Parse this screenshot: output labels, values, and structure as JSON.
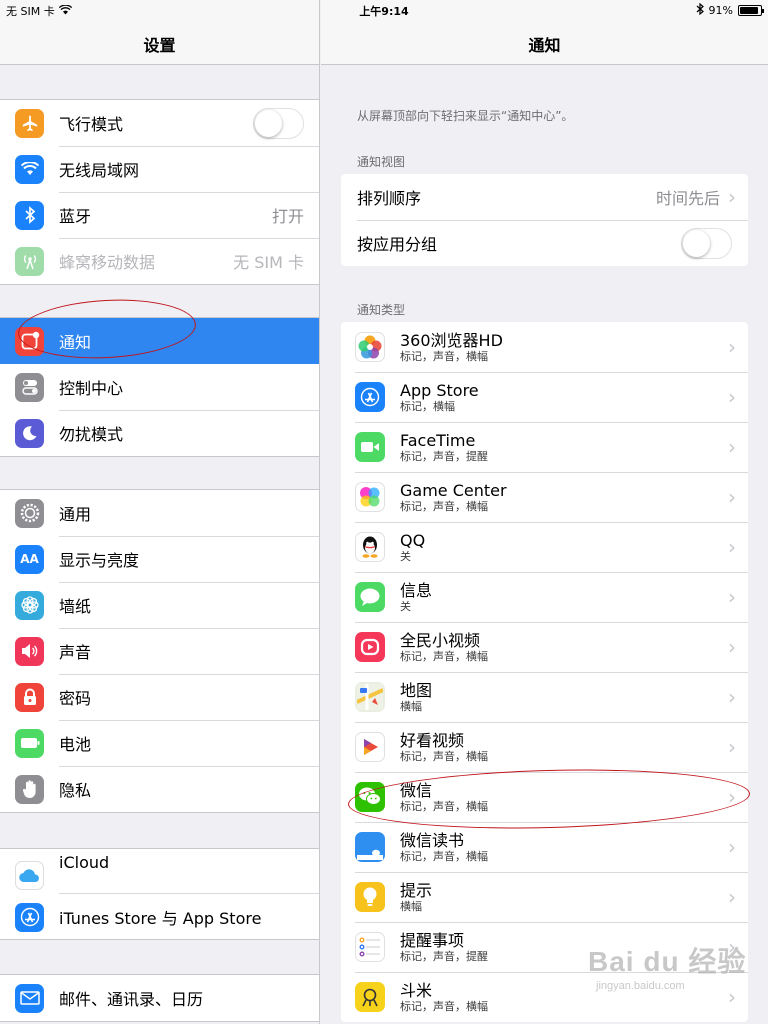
{
  "status": {
    "carrier": "无 SIM 卡",
    "time": "上午9:14",
    "battery": "91%",
    "battery_level": 0.91
  },
  "master": {
    "title": "设置",
    "groups": [
      [
        {
          "label": "飞行模式",
          "icon": "airplane-icon",
          "color": "#f59a23",
          "accessory": "toggle",
          "toggle_on": false
        },
        {
          "label": "无线局域网",
          "icon": "wifi-icon",
          "color": "#1a82fb",
          "accessory": "none"
        },
        {
          "label": "蓝牙",
          "icon": "bluetooth-icon",
          "color": "#1a82fb",
          "value": "打开",
          "accessory": "value"
        },
        {
          "label": "蜂窝移动数据",
          "icon": "cellular-icon",
          "color": "#9fdcaa",
          "value": "无 SIM 卡",
          "accessory": "value",
          "disabled": true
        }
      ],
      [
        {
          "label": "通知",
          "icon": "notifications-icon",
          "color": "#f0433a",
          "accessory": "none",
          "selected": true
        },
        {
          "label": "控制中心",
          "icon": "control-center-icon",
          "color": "#8e8e93",
          "accessory": "none"
        },
        {
          "label": "勿扰模式",
          "icon": "moon-icon",
          "color": "#5b5bd6",
          "accessory": "none"
        }
      ],
      [
        {
          "label": "通用",
          "icon": "gear-icon",
          "color": "#8e8e93",
          "accessory": "none"
        },
        {
          "label": "显示与亮度",
          "icon": "display-icon",
          "color": "#1a82fb",
          "accessory": "none",
          "glyph": "AA"
        },
        {
          "label": "墙纸",
          "icon": "wallpaper-icon",
          "color": "#35aadc",
          "accessory": "none"
        },
        {
          "label": "声音",
          "icon": "speaker-icon",
          "color": "#f0375a",
          "accessory": "none"
        },
        {
          "label": "密码",
          "icon": "lock-icon",
          "color": "#f0433a",
          "accessory": "none"
        },
        {
          "label": "电池",
          "icon": "battery-icon",
          "color": "#4cd964",
          "accessory": "none"
        },
        {
          "label": "隐私",
          "icon": "hand-icon",
          "color": "#8e8e93",
          "accessory": "none"
        }
      ],
      [
        {
          "label": "iCloud",
          "icon": "icloud-icon",
          "color": "#ffffff",
          "accessory": "none"
        },
        {
          "label": "iTunes Store 与 App Store",
          "icon": "app-store-icon",
          "color": "#1a82fb",
          "accessory": "none"
        }
      ],
      [
        {
          "label": "邮件、通讯录、日历",
          "icon": "mail-icon",
          "color": "#1a82fb",
          "accessory": "none"
        }
      ]
    ]
  },
  "detail": {
    "title": "通知",
    "hint": "从屏幕顶部向下轻扫来显示“通知中心”。",
    "view_section": "通知视图",
    "sort_label": "排列顺序",
    "sort_value": "时间先后",
    "group_label": "按应用分组",
    "group_toggle_on": false,
    "types_section": "通知类型",
    "apps": [
      {
        "name": "360浏览器HD",
        "sub": "标记，声音，横幅",
        "icon": "browser-360-icon",
        "color": "#ffffff"
      },
      {
        "name": "App Store",
        "sub": "标记，横幅",
        "icon": "app-store-icon",
        "color": "#1a82fb"
      },
      {
        "name": "FaceTime",
        "sub": "标记，声音，提醒",
        "icon": "facetime-icon",
        "color": "#4cd964"
      },
      {
        "name": "Game Center",
        "sub": "标记，声音，横幅",
        "icon": "game-center-icon",
        "color": "#ffffff"
      },
      {
        "name": "QQ",
        "sub": "关",
        "icon": "qq-icon",
        "color": "#ffffff"
      },
      {
        "name": "信息",
        "sub": "关",
        "icon": "messages-icon",
        "color": "#4cd964"
      },
      {
        "name": "全民小视频",
        "sub": "标记，声音，横幅",
        "icon": "video-app-icon",
        "color": "#f5385a"
      },
      {
        "name": "地图",
        "sub": "横幅",
        "icon": "maps-icon",
        "color": "#e9efe0"
      },
      {
        "name": "好看视频",
        "sub": "标记，声音，横幅",
        "icon": "haokan-icon",
        "color": "#ffffff"
      },
      {
        "name": "微信",
        "sub": "标记，声音，横幅",
        "icon": "wechat-icon",
        "color": "#2dc100"
      },
      {
        "name": "微信读书",
        "sub": "标记，声音，横幅",
        "icon": "wechat-read-icon",
        "color": "#2f8ff0"
      },
      {
        "name": "提示",
        "sub": "横幅",
        "icon": "tips-icon",
        "color": "#f7c21b"
      },
      {
        "name": "提醒事项",
        "sub": "标记，声音，提醒",
        "icon": "reminders-icon",
        "color": "#ffffff"
      },
      {
        "name": "斗米",
        "sub": "标记，声音，横幅",
        "icon": "doumi-icon",
        "color": "#f7d21b"
      }
    ]
  },
  "watermark": {
    "main": "Bai du 经验",
    "sub": "jingyan.baidu.com"
  }
}
